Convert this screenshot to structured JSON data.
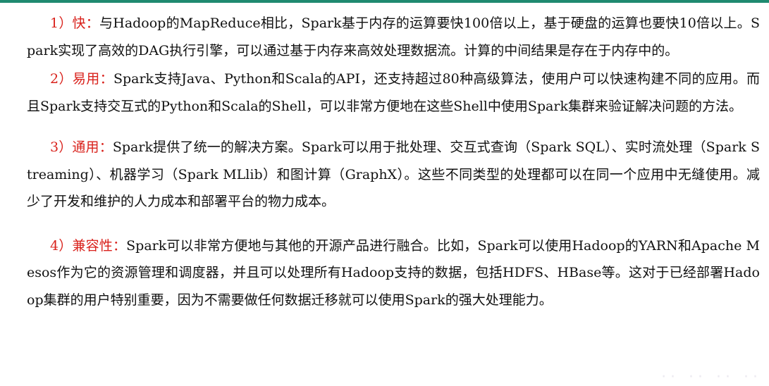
{
  "paragraphs": [
    {
      "label": "1）快：",
      "text": "与Hadoop的MapReduce相比，Spark基于内存的运算要快100倍以上，基于硬盘的运算也要快10倍以上。Spark实现了高效的DAG执行引擎，可以通过基于内存来高效处理数据流。计算的中间结果是存在于内存中的。"
    },
    {
      "label": "2）易用：",
      "text": "Spark支持Java、Python和Scala的API，还支持超过80种高级算法，使用户可以快速构建不同的应用。而且Spark支持交互式的Python和Scala的Shell，可以非常方便地在这些Shell中使用Spark集群来验证解决问题的方法。"
    },
    {
      "label": "3）通用：",
      "text": "Spark提供了统一的解决方案。Spark可以用于批处理、交互式查询（Spark SQL）、实时流处理（Spark Streaming）、机器学习（Spark MLlib）和图计算（GraphX）。这些不同类型的处理都可以在同一个应用中无缝使用。减少了开发和维护的人力成本和部署平台的物力成本。"
    },
    {
      "label": "4）兼容性：",
      "text": "Spark可以非常方便地与其他的开源产品进行融合。比如，Spark可以使用Hadoop的YARN和Apache Mesos作为它的资源管理和调度器，并且可以处理所有Hadoop支持的数据，包括HDFS、HBase等。这对于已经部署Hadoop集群的用户特别重要，因为不需要做任何数据迁移就可以使用Spark的强大处理能力。"
    }
  ],
  "colors": {
    "label": "#d9221c",
    "body_text": "#111111",
    "top_rule": "#1f8a70"
  }
}
